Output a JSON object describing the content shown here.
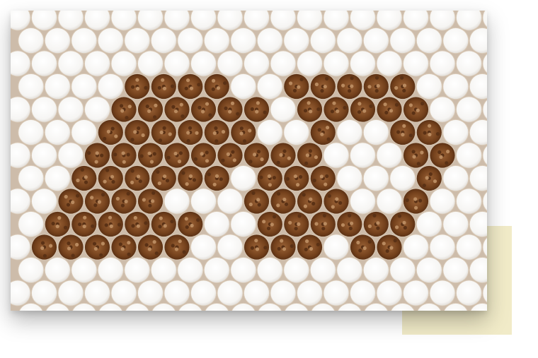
{
  "photo": {
    "subject": "",
    "colors": {
      "filter_paper": "#fbfbfb",
      "filter_shade": "#e9e6e2",
      "gap_background": "#c9b8a6",
      "tobacco_dark": "#5a3115",
      "tobacco_mid": "#8a5530",
      "tobacco_light": "#b98a5f",
      "accent_block": "#f1ebc8"
    }
  }
}
